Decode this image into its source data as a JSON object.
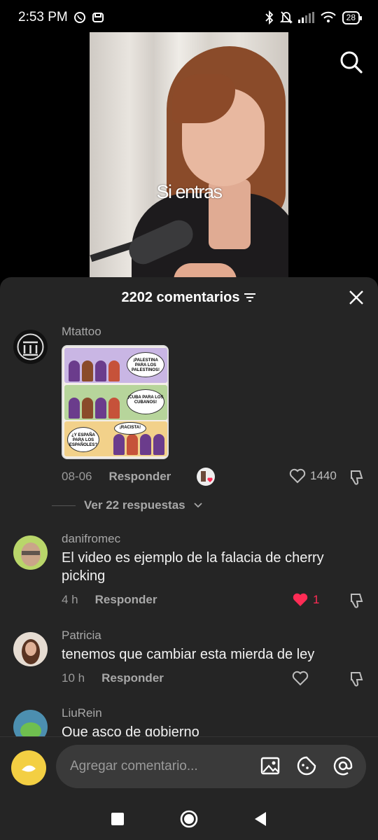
{
  "status_bar": {
    "time": "2:53 PM",
    "battery": "28",
    "icons": [
      "whatsapp-icon",
      "tiktok-icon",
      "bluetooth-icon",
      "mute-icon",
      "signal-icon",
      "wifi-icon",
      "battery-icon"
    ]
  },
  "video": {
    "caption": "Si entras"
  },
  "comments_sheet": {
    "title": "2202 comentarios",
    "comments": [
      {
        "username": "Mtattoo",
        "text": "",
        "has_image": true,
        "image_bubbles": [
          "¡PALESTINA PARA LOS PALESTINOS!",
          "¡CUBA PARA LOS CUBANOS!",
          "¿Y ESPAÑA PARA LOS ESPAÑOLES?",
          "¡RACISTA!"
        ],
        "date": "08-06",
        "reply_label": "Responder",
        "likes": "1440",
        "view_replies": "Ver 22 respuestas"
      },
      {
        "username": "danifromec",
        "text_line1": "El video es ejemplo de la falacia de cherry",
        "text_line2": "picking",
        "date": "4 h",
        "reply_label": "Responder",
        "likes": "1",
        "liked": true
      },
      {
        "username": "Patricia",
        "text": "tenemos que cambiar esta mierda de ley",
        "date": "10 h",
        "reply_label": "Responder"
      },
      {
        "username": "LiuRein",
        "text": "Que asco de gobierno"
      }
    ]
  },
  "input": {
    "placeholder": "Agregar comentario..."
  },
  "colors": {
    "sheet_bg": "#252525",
    "like_red": "#fe2c55"
  }
}
